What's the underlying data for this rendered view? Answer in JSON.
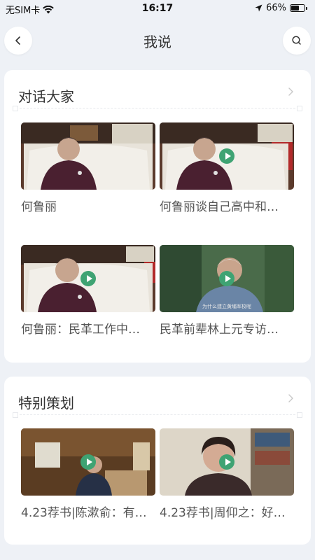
{
  "status": {
    "carrier": "无SIM卡",
    "time": "16:17",
    "battery": "66%",
    "battery_level": 0.66
  },
  "nav": {
    "title": "我说",
    "back_icon": "chevron-left-icon",
    "search_icon": "search-icon"
  },
  "sections": [
    {
      "title": "对话大家",
      "items": [
        {
          "title": "何鲁丽",
          "has_play": false
        },
        {
          "title": "何鲁丽谈自己高中和…",
          "has_play": true
        },
        {
          "title": "何鲁丽：民革工作中…",
          "has_play": true
        },
        {
          "title": "民革前辈林上元专访…",
          "has_play": true,
          "subtitle": "为什么建立黄埔军校呢"
        }
      ]
    },
    {
      "title": "特别策划",
      "items": [
        {
          "title": "4.23荐书|陈漱俞：有…",
          "has_play": true
        },
        {
          "title": "4.23荐书|周仰之：好…",
          "has_play": true
        }
      ]
    }
  ]
}
